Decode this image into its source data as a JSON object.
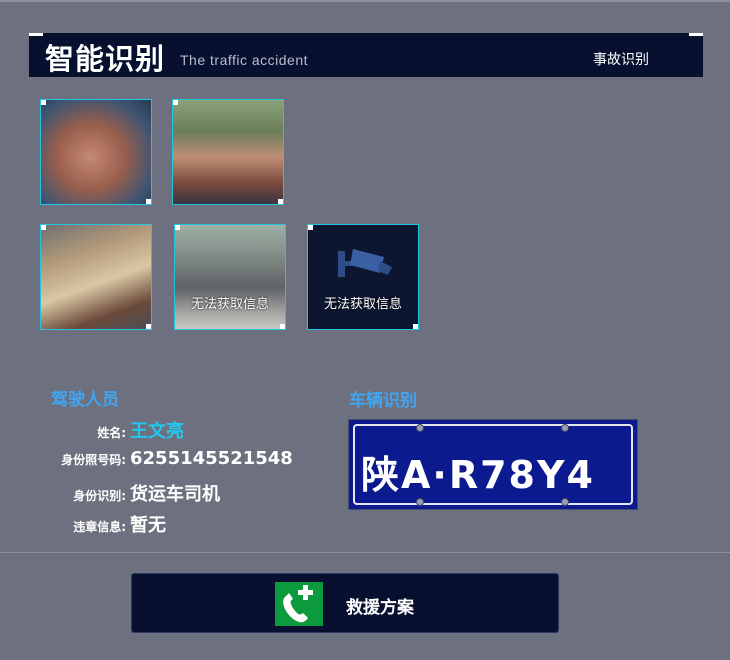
{
  "header": {
    "title": "智能识别",
    "subtitle": "The traffic accident",
    "tab_label": "事故识别"
  },
  "gallery": {
    "items": [
      {
        "caption": ""
      },
      {
        "caption": ""
      },
      {
        "caption": ""
      },
      {
        "caption": "无法获取信息"
      },
      {
        "caption": "无法获取信息"
      }
    ]
  },
  "driver": {
    "section_title": "驾驶人员",
    "name_label": "姓名:",
    "name_value": "王文亮",
    "id_label": "身份照号码:",
    "id_value": "6255145521548",
    "identity_label": "身份识别:",
    "identity_value": "货运车司机",
    "violation_label": "违章信息:",
    "violation_value": "暂无"
  },
  "vehicle": {
    "section_title": "车辆识别",
    "plate": "陕A·R78Y4"
  },
  "rescue": {
    "label": "救援方案"
  },
  "colors": {
    "background": "#6d717f",
    "panel": "#07112f",
    "accent": "#41a5f0",
    "highlight": "#21c9f1",
    "thumb_border": "#22c4de",
    "plate_blue": "#0c1a8f",
    "rescue_green": "#0d9a3e"
  },
  "icons": {
    "camera": "camera-icon",
    "phone": "phone-cross-icon"
  }
}
